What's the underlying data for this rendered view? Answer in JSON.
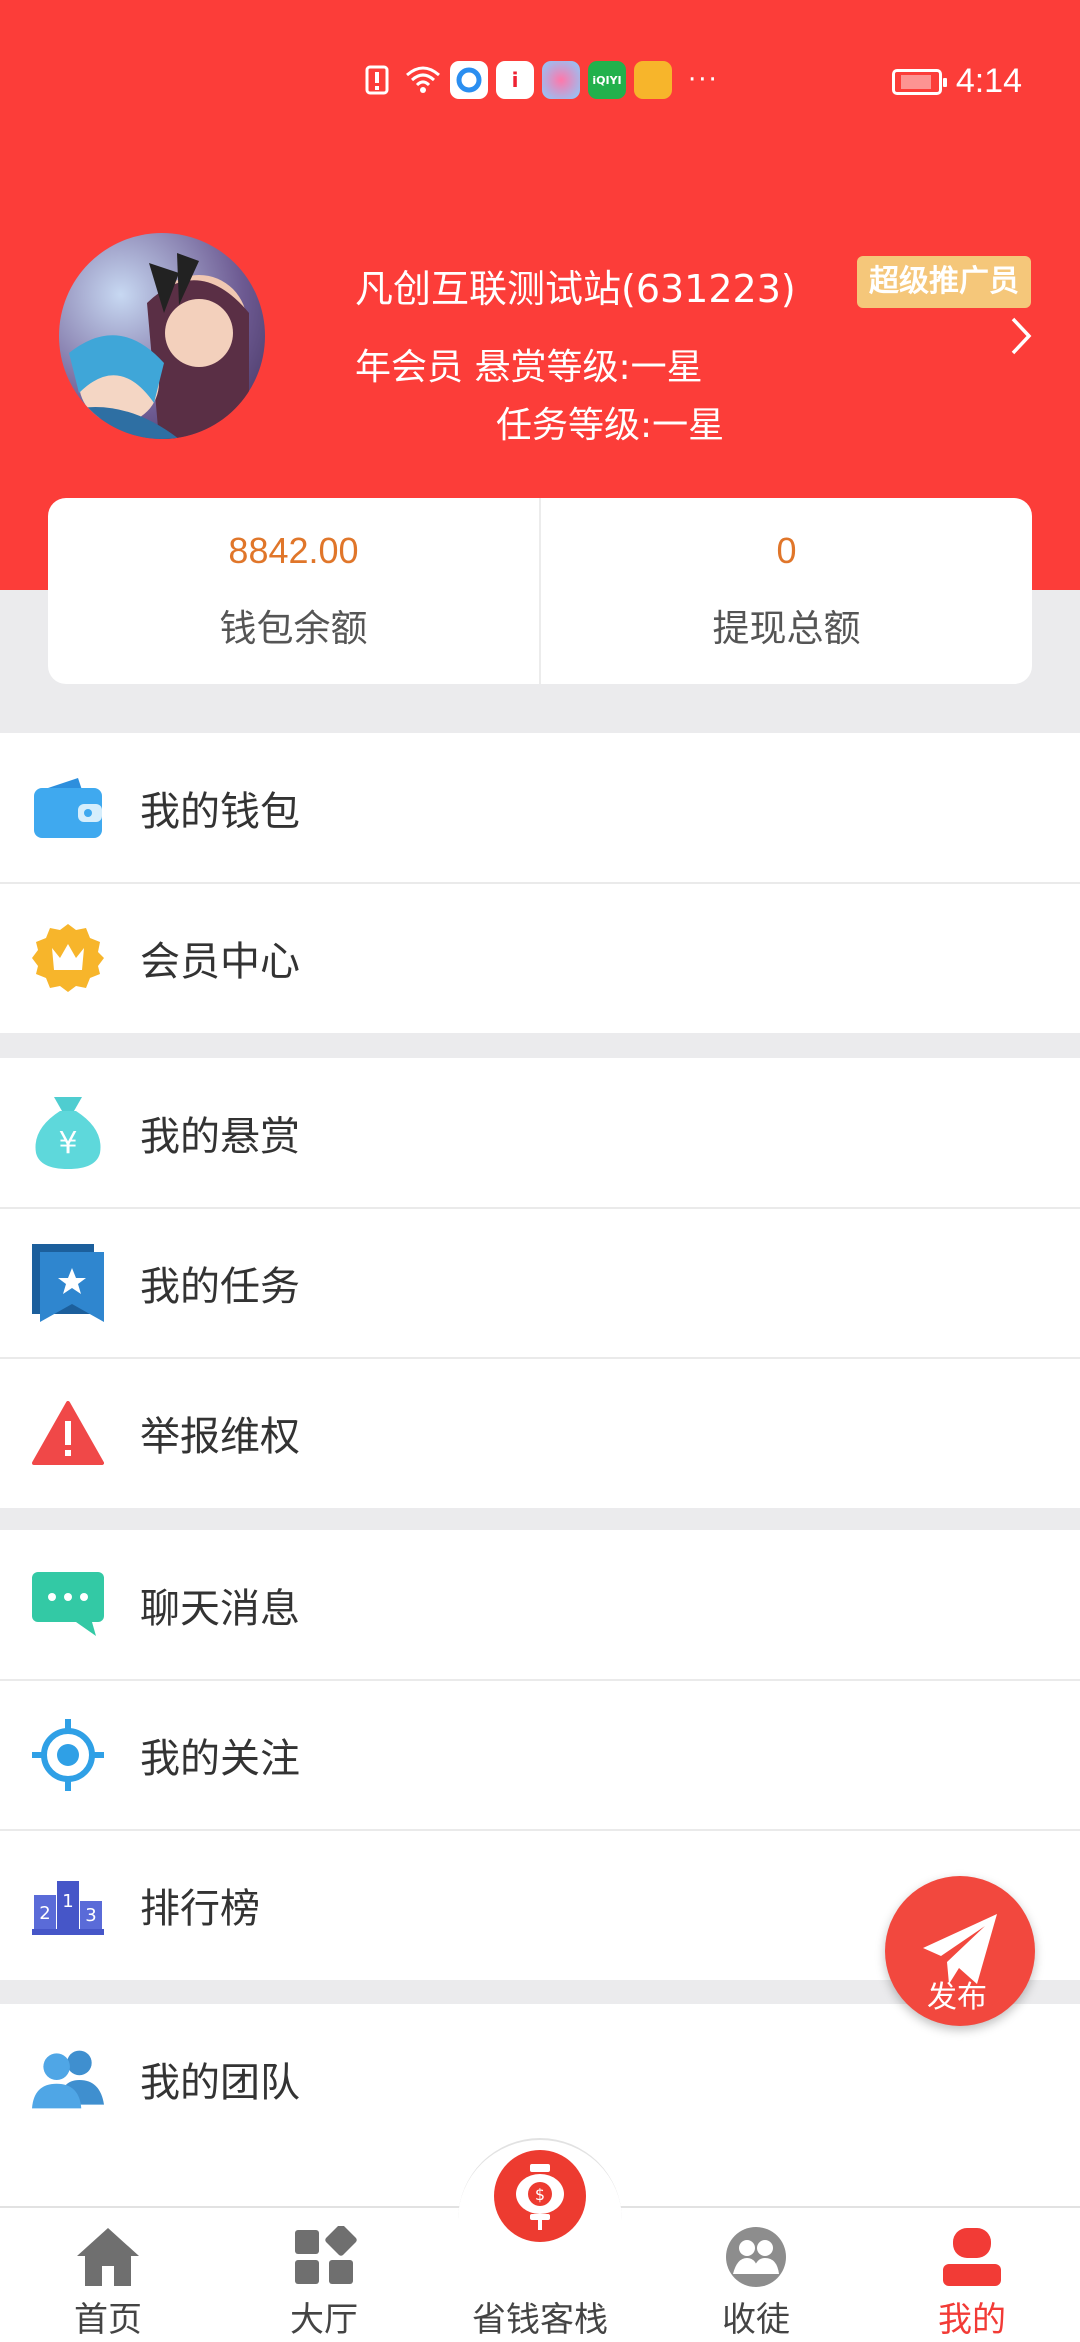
{
  "status_bar": {
    "time": "4:14",
    "more": "···",
    "app_badge": "i",
    "iqiyi_badge": "iQIYI"
  },
  "profile": {
    "name": "凡创互联测试站(631223)",
    "badge": "超级推广员",
    "membership_line": "年会员  悬赏等级:一星",
    "task_level": "任务等级:一星"
  },
  "stats": [
    {
      "value": "8842.00",
      "label": "钱包余额"
    },
    {
      "value": "0",
      "label": "提现总额"
    }
  ],
  "menu": {
    "group1": [
      {
        "label": "我的钱包",
        "icon": "wallet-icon"
      },
      {
        "label": "会员中心",
        "icon": "crown-icon"
      }
    ],
    "group2": [
      {
        "label": "我的悬赏",
        "icon": "money-bag-icon"
      },
      {
        "label": "我的任务",
        "icon": "task-flag-icon"
      },
      {
        "label": "举报维权",
        "icon": "warning-icon"
      }
    ],
    "group3": [
      {
        "label": "聊天消息",
        "icon": "chat-icon"
      },
      {
        "label": "我的关注",
        "icon": "target-icon"
      },
      {
        "label": "排行榜",
        "icon": "podium-icon"
      }
    ],
    "group4": [
      {
        "label": "我的团队",
        "icon": "team-icon"
      }
    ]
  },
  "fab": {
    "label": "发布",
    "icon": "paper-plane-icon"
  },
  "tabs": [
    {
      "label": "首页",
      "icon": "home-icon"
    },
    {
      "label": "大厅",
      "icon": "grid-icon"
    },
    {
      "label": "省钱客栈",
      "icon": "money-lantern-icon"
    },
    {
      "label": "收徒",
      "icon": "disciples-icon"
    },
    {
      "label": "我的",
      "icon": "person-icon",
      "active": true
    }
  ],
  "colors": {
    "brand_red": "#fc3d39",
    "accent_orange": "#e0762a",
    "badge_gold": "#f5c77a"
  }
}
